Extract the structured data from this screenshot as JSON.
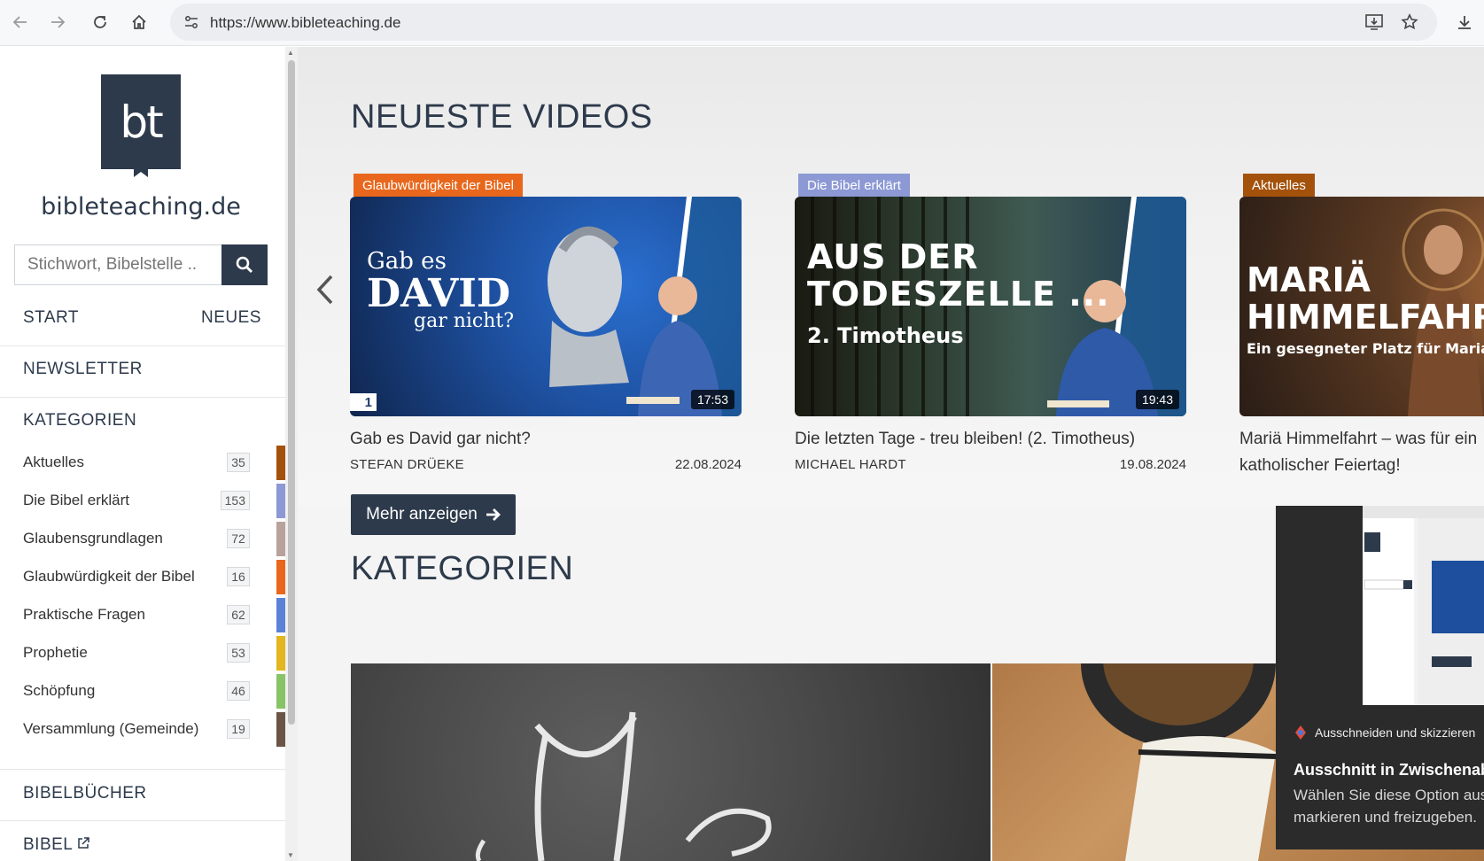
{
  "browser": {
    "url": "https://www.bibleteaching.de",
    "back_icon": "arrow-left-icon",
    "forward_icon": "arrow-right-icon",
    "reload_icon": "reload-icon",
    "home_icon": "home-icon"
  },
  "sidebar": {
    "logo_text": "bt",
    "site_name": "bibleteaching.de",
    "search_placeholder": "Stichwort, Bibelstelle ..",
    "nav_start": "START",
    "nav_neues": "NEUES",
    "newsletter": "NEWSLETTER",
    "kategorien_head": "KATEGORIEN",
    "categories": [
      {
        "name": "Aktuelles",
        "count": "35",
        "color": "#a4520b"
      },
      {
        "name": "Die Bibel erklärt",
        "count": "153",
        "color": "#8d99d4"
      },
      {
        "name": "Glaubensgrundlagen",
        "count": "72",
        "color": "#b9a29b"
      },
      {
        "name": "Glaubwürdigkeit der Bibel",
        "count": "16",
        "color": "#e8671c"
      },
      {
        "name": "Praktische Fragen",
        "count": "62",
        "color": "#5b82d6"
      },
      {
        "name": "Prophetie",
        "count": "53",
        "color": "#e3b51f"
      },
      {
        "name": "Schöpfung",
        "count": "46",
        "color": "#88c467"
      },
      {
        "name": "Versammlung (Gemeinde)",
        "count": "19",
        "color": "#6b5446"
      }
    ],
    "bibelbuecher": "BIBELBÜCHER",
    "bibel": "BIBEL"
  },
  "main": {
    "latest_title": "NEUESTE VIDEOS",
    "more_button": "Mehr anzeigen",
    "categories_title": "KATEGORIEN",
    "videos": [
      {
        "badge": "Glaubwürdigkeit der Bibel",
        "badge_color": "#e8671c",
        "thumb_line1": "Gab es",
        "thumb_line2": "DAVID",
        "thumb_line3": "gar nicht?",
        "duration": "17:53",
        "title": "Gab es David gar nicht?",
        "author": "STEFAN DRÜEKE",
        "date": "22.08.2024"
      },
      {
        "badge": "Die Bibel erklärt",
        "badge_color": "#8d99d4",
        "thumb_line1": "AUS DER",
        "thumb_line2": "TODESZELLE ...",
        "thumb_line3": "2. Timotheus",
        "duration": "19:43",
        "title": "Die letzten Tage - treu bleiben! (2. Timotheus)",
        "author": "MICHAEL HARDT",
        "date": "19.08.2024"
      },
      {
        "badge": "Aktuelles",
        "badge_color": "#a4520b",
        "thumb_line1": "MARIÄ",
        "thumb_line2": "HIMMELFAHRT",
        "thumb_line3": "Ein gesegneter Platz für Maria",
        "title_line1": "Mariä Himmelfahrt – was für ein",
        "title_line2": "katholischer Feiertag!"
      }
    ]
  },
  "snip": {
    "app": "Ausschneiden und skizzieren",
    "title": "Ausschnitt in Zwischenablage kopiert",
    "body_line1": "Wählen Sie diese Option aus, um zu",
    "body_line2": "markieren und freizugeben."
  }
}
